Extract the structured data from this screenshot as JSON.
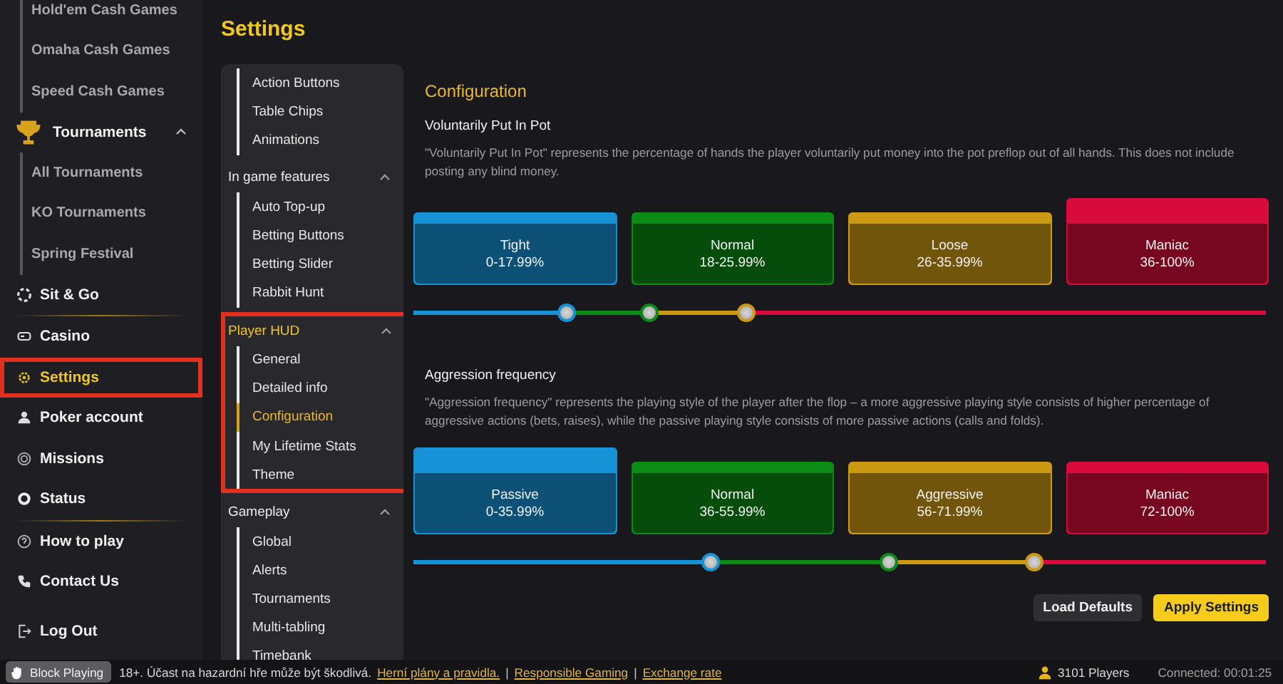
{
  "sidebar": {
    "items": [
      {
        "children": [
          {
            "label": "Hold'em Cash Games"
          },
          {
            "label": "Omaha Cash Games"
          },
          {
            "label": "Speed Cash Games"
          }
        ]
      },
      {
        "label": "Tournaments",
        "expanded": true,
        "selected": false,
        "highlighted": false,
        "children": [
          {
            "label": "All Tournaments"
          },
          {
            "label": "KO Tournaments"
          },
          {
            "label": "Spring Festival"
          }
        ]
      },
      {
        "label": "Sit & Go",
        "selected": false,
        "highlighted": false
      },
      {
        "label": "Casino",
        "selected": false,
        "highlighted": false
      },
      {
        "label": "Settings",
        "selected": true,
        "highlighted": true
      },
      {
        "label": "Poker account",
        "selected": false,
        "highlighted": false
      },
      {
        "label": "Missions",
        "selected": false,
        "highlighted": false
      },
      {
        "label": "Status",
        "selected": false,
        "highlighted": false
      },
      {
        "label": "How to play",
        "selected": false,
        "highlighted": false
      },
      {
        "label": "Contact Us",
        "selected": false,
        "highlighted": false
      },
      {
        "label": "Log Out",
        "selected": false,
        "highlighted": false
      }
    ]
  },
  "page_title": "Settings",
  "subnav": {
    "groups": [
      {
        "children": [
          {
            "label": "Action Buttons",
            "selected": false
          },
          {
            "label": "Table Chips",
            "selected": false
          },
          {
            "label": "Animations",
            "selected": false
          }
        ]
      },
      {
        "label": "In game features",
        "expanded": true,
        "highlighted": false,
        "children": [
          {
            "label": "Auto Top-up",
            "selected": false
          },
          {
            "label": "Betting Buttons",
            "selected": false
          },
          {
            "label": "Betting Slider",
            "selected": false
          },
          {
            "label": "Rabbit Hunt",
            "selected": false
          }
        ]
      },
      {
        "label": "Player HUD",
        "expanded": true,
        "highlighted": true,
        "children": [
          {
            "label": "General",
            "selected": false
          },
          {
            "label": "Detailed info",
            "selected": false
          },
          {
            "label": "Configuration",
            "selected": true
          },
          {
            "label": "My Lifetime Stats",
            "selected": false
          },
          {
            "label": "Theme",
            "selected": false
          }
        ]
      },
      {
        "label": "Gameplay",
        "expanded": true,
        "highlighted": false,
        "children": [
          {
            "label": "Global",
            "selected": false
          },
          {
            "label": "Alerts",
            "selected": false
          },
          {
            "label": "Tournaments",
            "selected": false
          },
          {
            "label": "Multi-tabling",
            "selected": false
          },
          {
            "label": "Timebank",
            "selected": false
          }
        ]
      }
    ]
  },
  "content": {
    "title": "Configuration",
    "sections": [
      {
        "title": "Voluntarily Put In Pot",
        "description": "\"Voluntarily Put In Pot\" represents the percentage of hands the player voluntarily put money into the pot preflop out of all hands. This does not include posting any blind money.",
        "cards": [
          {
            "label": "Tight",
            "range": "0-17.99%",
            "color": "#1593d6",
            "selected": false
          },
          {
            "label": "Normal",
            "range": "18-25.99%",
            "color": "#0b8c16",
            "selected": false
          },
          {
            "label": "Loose",
            "range": "26-35.99%",
            "color": "#cc9a12",
            "selected": false
          },
          {
            "label": "Maniac",
            "range": "36-100%",
            "color": "#d80b3c",
            "selected": true
          }
        ],
        "thumbs": [
          {
            "level": 0.179
          },
          {
            "level": 0.276
          },
          {
            "level": 0.39
          }
        ]
      },
      {
        "title": "Aggression frequency",
        "description": "\"Aggression frequency\" represents the playing style of the player after the flop – a more aggressive playing style consists of higher percentage of aggressive actions (bets, raises), while the passive playing style consists of more passive actions (calls and folds).",
        "cards": [
          {
            "label": "Passive",
            "range": "0-35.99%",
            "color": "#1593d6",
            "selected": true
          },
          {
            "label": "Normal",
            "range": "36-55.99%",
            "color": "#0b8c16",
            "selected": false
          },
          {
            "label": "Aggressive",
            "range": "56-71.99%",
            "color": "#cc9a12",
            "selected": false
          },
          {
            "label": "Maniac",
            "range": "72-100%",
            "color": "#d80b3c",
            "selected": false
          }
        ],
        "thumbs": [
          {
            "level": 0.348
          },
          {
            "level": 0.557
          },
          {
            "level": 0.727
          }
        ]
      }
    ],
    "buttons": [
      {
        "label": "Load Defaults",
        "kind": "secondary"
      },
      {
        "label": "Apply Settings",
        "kind": "primary"
      }
    ]
  },
  "status_bar": {
    "block_button": "Block Playing",
    "notice": "18+. Účast na hazardní hře může být škodlivá.",
    "links": [
      {
        "label": "Herní plány a pravidla.",
        "kind": "link"
      },
      {
        "label": "|",
        "kind": "separator"
      },
      {
        "label": "Responsible Gaming",
        "kind": "link"
      },
      {
        "label": "|",
        "kind": "separator"
      },
      {
        "label": "Exchange rate",
        "kind": "link"
      }
    ],
    "players": "3101 Players",
    "connection": "Connected: 00:01:25"
  }
}
